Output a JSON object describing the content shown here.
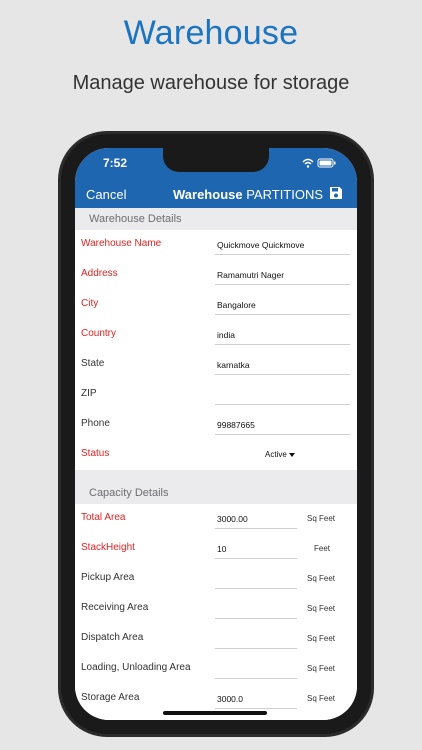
{
  "promo": {
    "title": "Warehouse",
    "subtitle": "Manage warehouse for storage"
  },
  "statusbar": {
    "time": "7:52"
  },
  "navbar": {
    "cancel_label": "Cancel",
    "title_strong": "Warehouse",
    "title_rest": "PARTITIONS",
    "save_icon": "save-icon"
  },
  "colors": {
    "brand": "#1f66b0",
    "promo_title": "#1b74c2",
    "required_label": "#e32222",
    "section_bg": "#ebebed"
  },
  "warehouse_details": {
    "header": "Warehouse Details",
    "fields": [
      {
        "label": "Warehouse Name",
        "value": "Quickmove Quickmove",
        "required": true
      },
      {
        "label": "Address",
        "value": "Ramamutri Nager",
        "required": true
      },
      {
        "label": "City",
        "value": "Bangalore",
        "required": true
      },
      {
        "label": "Country",
        "value": "india",
        "required": true
      },
      {
        "label": "State",
        "value": "karnatka",
        "required": false
      },
      {
        "label": "ZIP",
        "value": "",
        "required": false
      },
      {
        "label": "Phone",
        "value": "99887665",
        "required": false
      }
    ],
    "status": {
      "label": "Status",
      "value": "Active"
    }
  },
  "capacity_details": {
    "header": "Capacity Details",
    "fields": [
      {
        "label": "Total Area",
        "value": "3000.00",
        "unit": "Sq Feet",
        "required": true
      },
      {
        "label": "StackHeight",
        "value": "10",
        "unit": "Feet",
        "required": true
      },
      {
        "label": "Pickup Area",
        "value": "",
        "unit": "Sq Feet",
        "required": false
      },
      {
        "label": "Receiving Area",
        "value": "",
        "unit": "Sq Feet",
        "required": false
      },
      {
        "label": "Dispatch Area",
        "value": "",
        "unit": "Sq Feet",
        "required": false
      },
      {
        "label": "Loading, Unloading Area",
        "value": "",
        "unit": "Sq Feet",
        "required": false
      },
      {
        "label": "Storage Area",
        "value": "3000.0",
        "unit": "Sq Feet",
        "required": false
      }
    ]
  }
}
